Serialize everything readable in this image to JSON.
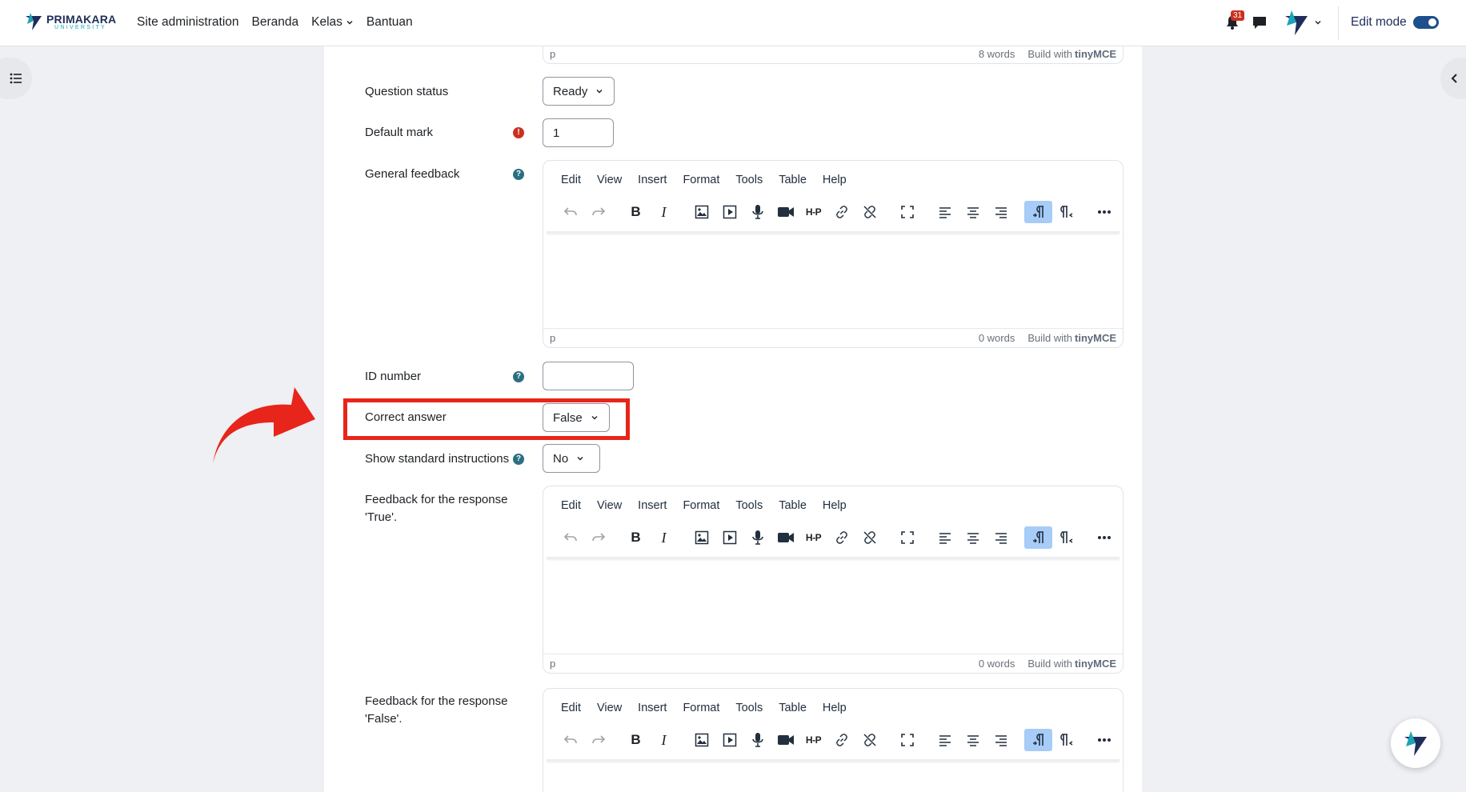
{
  "navbar": {
    "logo_name": "PRIMAKARA",
    "logo_sub": "UNIVERSITY",
    "links": [
      "Site administration",
      "Beranda",
      "Kelas",
      "Bantuan"
    ],
    "notification_count": "31",
    "edit_mode_label": "Edit mode",
    "edit_mode_on": true
  },
  "top_editor_status": {
    "path": "p",
    "words": "8 words",
    "build_with": "Build with",
    "brand": "tinyMCE"
  },
  "form": {
    "question_status": {
      "label": "Question status",
      "value": "Ready"
    },
    "default_mark": {
      "label": "Default mark",
      "value": "1"
    },
    "general_feedback": {
      "label": "General feedback"
    },
    "id_number": {
      "label": "ID number",
      "value": ""
    },
    "correct_answer": {
      "label": "Correct answer",
      "value": "False"
    },
    "show_instructions": {
      "label": "Show standard instructions",
      "value": "No"
    },
    "feedback_true": {
      "label": "Feedback for the response 'True'."
    },
    "feedback_false": {
      "label": "Feedback for the response 'False'."
    }
  },
  "editor": {
    "menu": [
      "Edit",
      "View",
      "Insert",
      "Format",
      "Tools",
      "Table",
      "Help"
    ],
    "toolbar_icons": [
      "undo-icon",
      "redo-icon",
      "bold-icon",
      "italic-icon",
      "image-icon",
      "media-icon",
      "microphone-icon",
      "video-icon",
      "h5p-icon",
      "link-icon",
      "unlink-icon",
      "fullscreen-icon",
      "align-left-icon",
      "align-center-icon",
      "align-right-icon",
      "ltr-icon",
      "rtl-icon",
      "more-icon"
    ],
    "bold_glyph": "B",
    "italic_glyph": "I",
    "h5p_glyph": "H-P",
    "status_path": "p",
    "words": "0 words",
    "build_with": "Build with",
    "brand": "tinyMCE"
  },
  "colors": {
    "accent": "#0f6cbf",
    "highlight": "#e8251a",
    "error": "#ca3120",
    "brand_dark": "#1f2d5a"
  }
}
